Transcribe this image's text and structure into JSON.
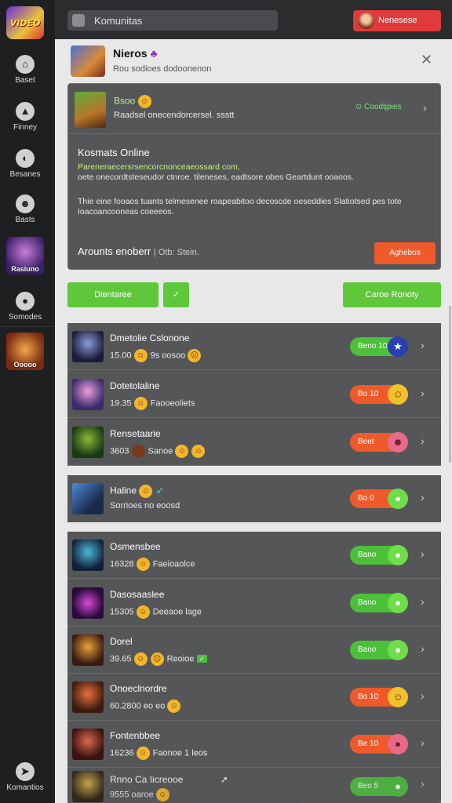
{
  "sidebar": {
    "logo_text": "VIDEO",
    "items": [
      {
        "label": "Baset",
        "icon": "home-icon"
      },
      {
        "label": "Finney",
        "icon": "house-icon"
      },
      {
        "label": "Besanes",
        "icon": "globe-icon"
      },
      {
        "label": "Basts",
        "icon": "robot-icon"
      }
    ],
    "game1_label": "Rasiuno",
    "chat_label": "Somodes",
    "game2_label": "Ooooo",
    "bottom_label": "Komantios",
    "bottom_icon": "send-icon"
  },
  "topbar": {
    "search_text": "Komunitas",
    "button_label": "Nenesese"
  },
  "panel": {
    "title": "Nieros",
    "title_glyph": "♣",
    "subtitle": "Rou sodioes dodoonenon"
  },
  "info_card": {
    "title": "Bsoo",
    "subtitle": "Raadsel onecendorcersel. ssstt",
    "link": "Coodtjpies",
    "heading": "Kosmats Online",
    "para1_green": "Pareneraecersrsencorcnonceaeossard com,",
    "para1_rest": "oete onecordtsteseudor ctnroe. tileneses, eadtsore obes Geartdunt ooaoos.",
    "para2": "Thie eine fooaos tuants telmesenee roapeabitoo decoscde oeseddies Slatiotsed pes tote Ioacoancooneas coeeeos.",
    "footer": "Arounts enoberr",
    "footer_sub": "| Otb: Stein.",
    "footer_button": "Aghebos"
  },
  "actions": {
    "left_button": "Dientaree",
    "small_button": "✓",
    "right_button": "Caroe Ronoty"
  },
  "rows": [
    {
      "name": "Dmetolie Cslonone",
      "count": "15.00",
      "extra": "9s oosoo",
      "pill": "Beno 10",
      "pill_color": "green",
      "bubble": "★"
    },
    {
      "name": "Dotetolaline",
      "count": "19.35",
      "extra": "Faooeoliets",
      "pill": "Bo 10",
      "pill_color": "orange",
      "bubble": "☺"
    },
    {
      "name": "Rensetaarie",
      "count": "3603",
      "extra": "Sanoe",
      "pill": "Beet",
      "pill_color": "orange",
      "bubble": "☻"
    },
    {
      "name": "Haline",
      "count": "",
      "extra": "Sorrioes no eoosd",
      "pill": "Bo 0",
      "pill_color": "orange",
      "bubble": "●"
    },
    {
      "name": "Osmensbee",
      "count": "16328",
      "extra": "Faeioaolce",
      "pill": "Bano",
      "pill_color": "green",
      "bubble": "●"
    },
    {
      "name": "Dasosaaslee",
      "count": "15305",
      "extra": "Deeaoe lage",
      "pill": "Bano",
      "pill_color": "green",
      "bubble": "●"
    },
    {
      "name": "Dorel",
      "count": "39.65",
      "extra": "Reoioe",
      "pill": "Bano",
      "pill_color": "green",
      "bubble": "●"
    },
    {
      "name": "Onoeclnordre",
      "count": "60.2800",
      "extra": "eo eo",
      "pill": "Bo 10",
      "pill_color": "orange",
      "bubble": "☺"
    },
    {
      "name": "Fontenbbee",
      "count": "16236",
      "extra": "Faonoe 1 leos",
      "pill": "Be 10",
      "pill_color": "orange",
      "bubble": "●"
    },
    {
      "name": "Rnno Ca Iicreooe",
      "count": "9555",
      "extra": "oaroe",
      "pill": "Beo 5",
      "pill_color": "green",
      "bubble": "●"
    }
  ]
}
